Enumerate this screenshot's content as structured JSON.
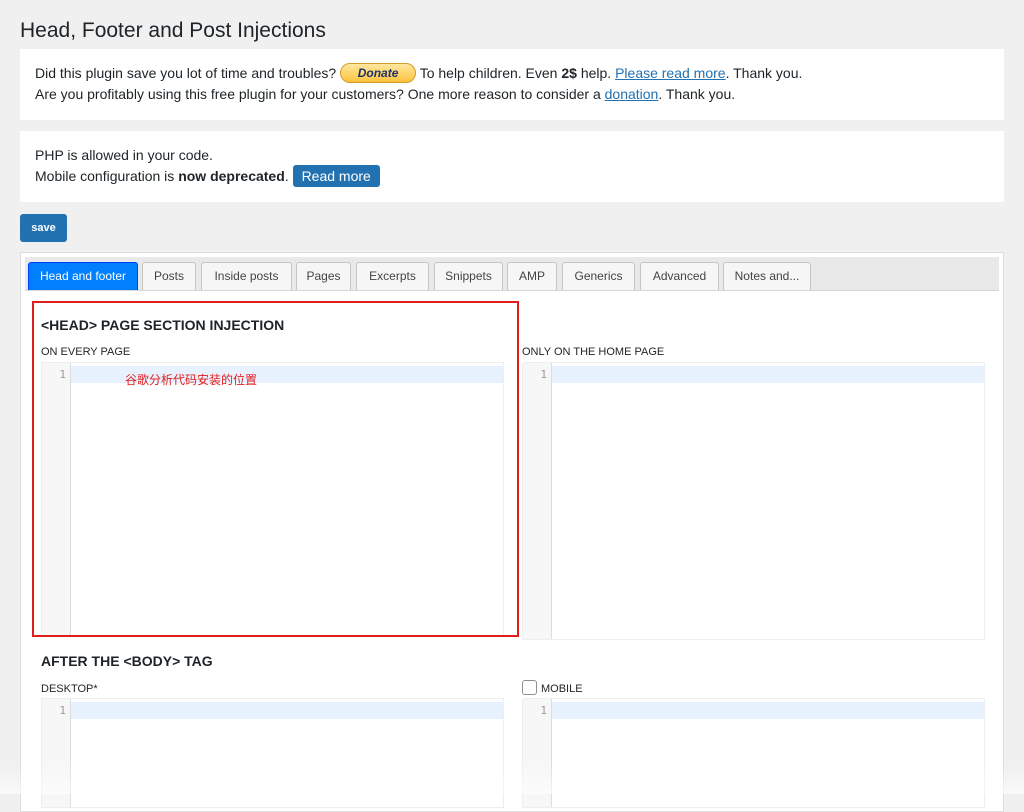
{
  "page": {
    "title": "Head, Footer and Post Injections"
  },
  "donate_notice": {
    "line1_prefix": "Did this plugin save you lot of time and troubles?",
    "donate_button": "Donate",
    "line1_middle": "To help children. Even",
    "line1_bold": "2$",
    "line1_after_bold": "help.",
    "please_read_more_link": "Please read more",
    "line1_suffix": ". Thank you.",
    "line2_prefix": "Are you profitably using this free plugin for your customers? One more reason to consider a",
    "donation_link": "donation",
    "line2_suffix": ". Thank you."
  },
  "php_notice": {
    "line1": "PHP is allowed in your code.",
    "line2_prefix": "Mobile configuration is",
    "line2_bold": "now deprecated",
    "line2_suffix": ".",
    "read_more_button": "Read more"
  },
  "toolbar": {
    "save_label": "save"
  },
  "tabs": [
    {
      "label": "Head and footer",
      "active": true
    },
    {
      "label": "Posts",
      "active": false
    },
    {
      "label": "Inside posts",
      "active": false
    },
    {
      "label": "Pages",
      "active": false
    },
    {
      "label": "Excerpts",
      "active": false
    },
    {
      "label": "Snippets",
      "active": false
    },
    {
      "label": "AMP",
      "active": false
    },
    {
      "label": "Generics",
      "active": false
    },
    {
      "label": "Advanced",
      "active": false
    },
    {
      "label": "Notes and...",
      "active": false
    }
  ],
  "head_section": {
    "title": "<HEAD> PAGE SECTION INJECTION",
    "every_page_label": "ON EVERY PAGE",
    "home_page_label": "ONLY ON THE HOME PAGE",
    "annotation": "谷歌分析代码安装的位置"
  },
  "body_section": {
    "title": "AFTER THE <BODY> TAG",
    "desktop_label": "DESKTOP*",
    "mobile_label": "MOBILE"
  },
  "editor": {
    "line_number": "1"
  },
  "colors": {
    "accent": "#2271b1",
    "active_tab": "#007fff",
    "highlight": "#e11d1d"
  }
}
